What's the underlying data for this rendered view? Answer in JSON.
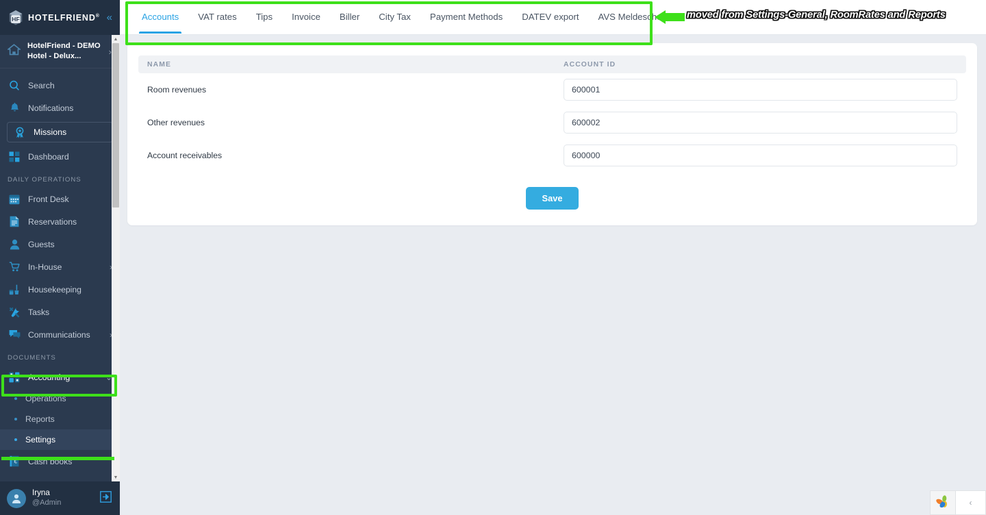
{
  "brand": {
    "name": "HOTELFRIEND",
    "registered_mark": "®",
    "collapse_icon": "chevron-double-left-icon"
  },
  "sidebar": {
    "property": {
      "label": "HotelFriend - DEMO Hotel - Delux...",
      "icon": "home-icon",
      "chevron": "›"
    },
    "top_items": [
      {
        "label": "Search",
        "icon": "search-icon"
      },
      {
        "label": "Notifications",
        "icon": "bell-icon"
      },
      {
        "label": "Missions",
        "icon": "award-icon",
        "boxed": true
      },
      {
        "label": "Dashboard",
        "icon": "dashboard-grid-icon"
      }
    ],
    "sections": [
      {
        "title": "DAILY OPERATIONS",
        "items": [
          {
            "label": "Front Desk",
            "icon": "calendar-icon",
            "arrow": ""
          },
          {
            "label": "Reservations",
            "icon": "document-icon",
            "arrow": ""
          },
          {
            "label": "Guests",
            "icon": "user-icon",
            "arrow": ""
          },
          {
            "label": "In-House",
            "icon": "cart-icon",
            "arrow": "›"
          },
          {
            "label": "Housekeeping",
            "icon": "broom-icon",
            "arrow": ""
          },
          {
            "label": "Tasks",
            "icon": "tools-icon",
            "arrow": ""
          },
          {
            "label": "Communications",
            "icon": "chat-icon",
            "arrow": "›"
          }
        ]
      },
      {
        "title": "DOCUMENTS",
        "items": [
          {
            "label": "Accounting",
            "icon": "accounting-grid-icon",
            "arrow": "⌄",
            "expanded": true
          }
        ],
        "subitems": [
          {
            "label": "Operations",
            "active": false
          },
          {
            "label": "Reports",
            "active": false
          },
          {
            "label": "Settings",
            "active": true
          }
        ],
        "after": [
          {
            "label": "Cash books",
            "icon": "cashbook-icon",
            "arrow": ""
          }
        ]
      }
    ],
    "user": {
      "name": "Iryna",
      "role": "@Admin",
      "avatar_icon": "user-avatar-icon",
      "logout_icon": "logout-icon"
    }
  },
  "tabs": [
    {
      "label": "Accounts",
      "active": true
    },
    {
      "label": "VAT rates",
      "active": false
    },
    {
      "label": "Tips",
      "active": false
    },
    {
      "label": "Invoice",
      "active": false
    },
    {
      "label": "Biller",
      "active": false
    },
    {
      "label": "City Tax",
      "active": false
    },
    {
      "label": "Payment Methods",
      "active": false
    },
    {
      "label": "DATEV export",
      "active": false
    },
    {
      "label": "AVS Meldeschein",
      "active": false
    }
  ],
  "table": {
    "columns": [
      "NAME",
      "ACCOUNT ID"
    ],
    "rows": [
      {
        "name": "Room revenues",
        "account_id": "600001"
      },
      {
        "name": "Other revenues",
        "account_id": "600002"
      },
      {
        "name": "Account receivables",
        "account_id": "600000"
      }
    ]
  },
  "actions": {
    "save_label": "Save"
  },
  "annotations": {
    "tabs_note": "moved from Settings-General, RoomRates and Reports",
    "highlight_color": "#3ee01a"
  },
  "chat_widget": {
    "logo_icon": "leaf-logo-icon",
    "collapse_icon": "chevron-left-icon"
  },
  "colors": {
    "accent": "#2aa3e4",
    "save_button": "#34ace0",
    "sidebar_bg": "#2b3a4f",
    "sidebar_header_bg": "#223042",
    "content_bg": "#e9ecf1"
  }
}
